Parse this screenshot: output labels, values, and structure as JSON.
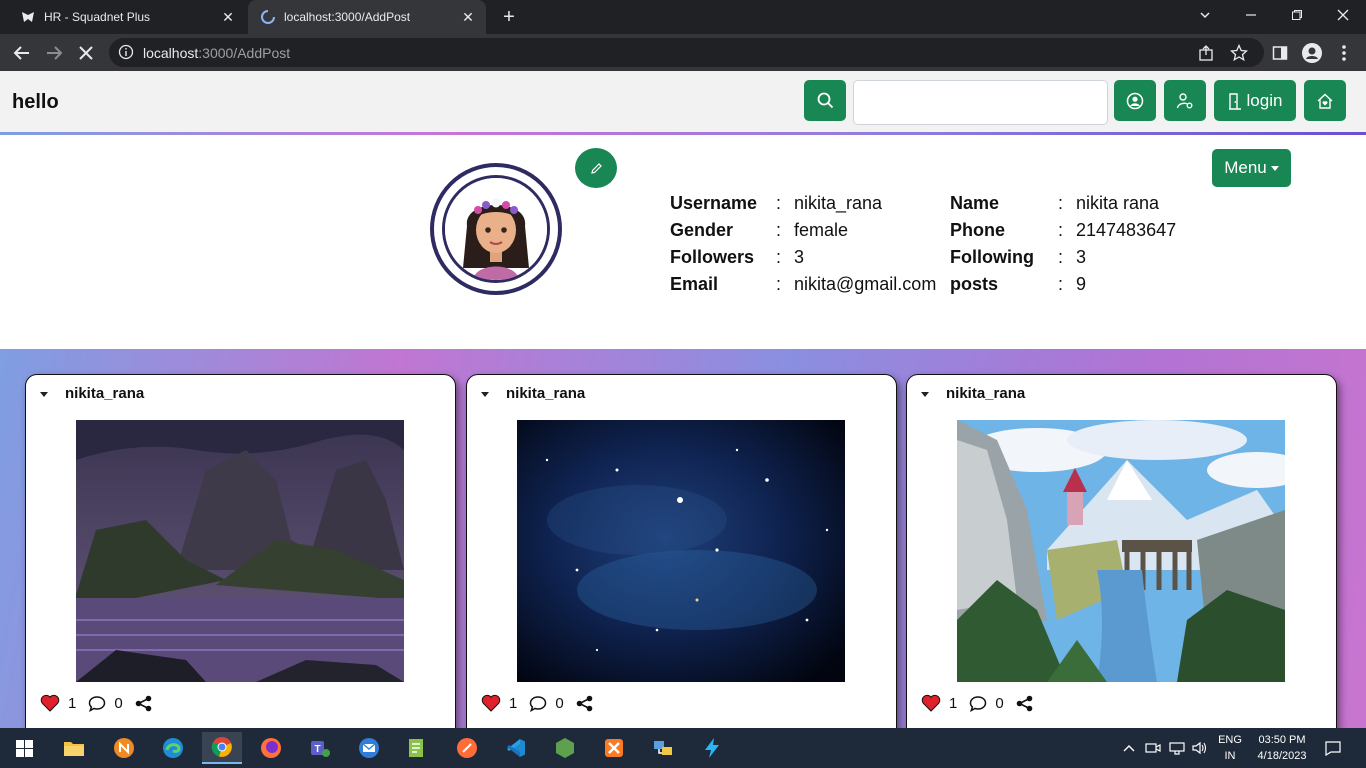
{
  "browser": {
    "tabs": [
      {
        "title": "HR - Squadnet Plus",
        "icon": "squadnet-favicon"
      },
      {
        "title": "localhost:3000/AddPost",
        "icon": "loading-spinner-icon"
      }
    ],
    "url_host": "localhost",
    "url_rest": ":3000/AddPost"
  },
  "navbar": {
    "brand": "hello",
    "search_value": "",
    "login_label": "login"
  },
  "profile": {
    "menu_label": "Menu",
    "fields": [
      {
        "label": "Username",
        "value": "nikita_rana"
      },
      {
        "label": "Gender",
        "value": "female"
      },
      {
        "label": "Followers",
        "value": "3"
      },
      {
        "label": "Email",
        "value": "nikita@gmail.com"
      },
      {
        "label": "Name",
        "value": "nikita rana"
      },
      {
        "label": "Phone",
        "value": "2147483647"
      },
      {
        "label": "Following",
        "value": "3"
      },
      {
        "label": "posts",
        "value": "9"
      }
    ],
    "separator": ":"
  },
  "posts": [
    {
      "username": "nikita_rana",
      "likes": "1",
      "comments": "0",
      "image": "purple-coastal-landscape"
    },
    {
      "username": "nikita_rana",
      "likes": "1",
      "comments": "0",
      "image": "starry-galaxy"
    },
    {
      "username": "nikita_rana",
      "likes": "1",
      "comments": "0",
      "image": "pixel-waterfall-castle"
    }
  ],
  "taskbar": {
    "lang_top": "ENG",
    "lang_bottom": "IN",
    "time": "03:50 PM",
    "date": "4/18/2023"
  },
  "colors": {
    "accent_green": "#198754",
    "chrome_dark": "#202124",
    "chrome_mid": "#35363a",
    "avatar_ring": "#2e2b62",
    "heart_red": "#e0202a"
  }
}
